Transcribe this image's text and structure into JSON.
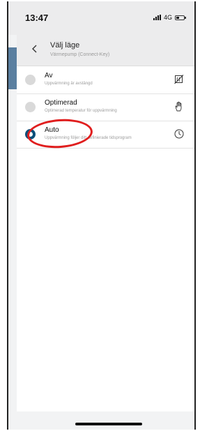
{
  "status_bar": {
    "time": "13:47",
    "network": "4G"
  },
  "header": {
    "title": "Välj läge",
    "subtitle": "Värmepump (Connect-Key)"
  },
  "options": [
    {
      "label": "Av",
      "description": "Uppvärmning är avstängd",
      "icon": "heating-off-icon",
      "selected": false
    },
    {
      "label": "Optimerad",
      "description": "Optimerad temperatur för uppvärmning",
      "icon": "hand-icon",
      "selected": false
    },
    {
      "label": "Auto",
      "description": "Uppvärmning följer ditt definierade tidsprogram",
      "icon": "clock-icon",
      "selected": true
    }
  ],
  "colors": {
    "selected_radio": "#0b4f7a",
    "annotation_circle": "#e01e1e"
  }
}
